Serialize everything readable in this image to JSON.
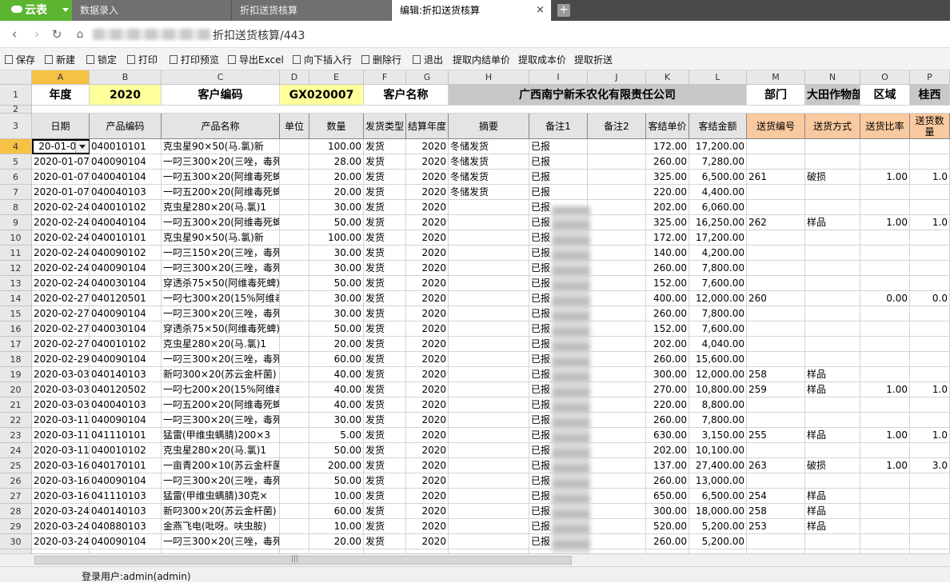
{
  "app": {
    "logo": "云表"
  },
  "tabs": [
    {
      "label": "数据录入"
    },
    {
      "label": "折扣送货核算"
    },
    {
      "label": "编辑:折扣送货核算",
      "active": true,
      "close": "×"
    }
  ],
  "newtab_symbol": "+",
  "address": {
    "path": "折扣送货核算/443"
  },
  "toolbar": [
    {
      "label": "保存",
      "icon": "save-icon"
    },
    {
      "label": "新建",
      "icon": "new-icon"
    },
    {
      "label": "锁定",
      "icon": "lock-icon"
    },
    {
      "label": "打印",
      "icon": "print-icon"
    },
    {
      "label": "打印预览",
      "icon": "print-preview-icon"
    },
    {
      "label": "导出Excel",
      "icon": "excel-icon"
    },
    {
      "label": "向下插入行",
      "icon": "insert-row-icon"
    },
    {
      "label": "删除行",
      "icon": "delete-row-icon"
    },
    {
      "label": "退出",
      "icon": "exit-icon"
    },
    {
      "label": "提取内结单价",
      "icon": ""
    },
    {
      "label": "提取成本价",
      "icon": ""
    },
    {
      "label": "提取折送",
      "icon": ""
    }
  ],
  "sheet": {
    "col_letters": [
      "A",
      "B",
      "C",
      "D",
      "E",
      "F",
      "G",
      "H",
      "I",
      "J",
      "K",
      "L",
      "M",
      "N",
      "O",
      "P"
    ],
    "header_row1": {
      "year_label": "年度",
      "year": "2020",
      "cust_code_label": "客户编码",
      "cust_code": "GX020007",
      "cust_name_label": "客户名称",
      "cust_name": "广西南宁新禾农化有限责任公司",
      "dept_label": "部门",
      "dept": "大田作物部",
      "region_label": "区域",
      "region": "桂西"
    },
    "columns": [
      "日期",
      "产品编码",
      "产品名称",
      "单位",
      "数量",
      "发货类型",
      "结算年度",
      "摘要",
      "备注1",
      "备注2",
      "客结单价",
      "客结金额",
      "送货编号",
      "送货方式",
      "送货比率",
      "送货数量"
    ],
    "first_row_number": 4,
    "rows": [
      [
        "2020-01-07",
        "040010101",
        "克虫星90×50(马.氯)新",
        "",
        "100.00",
        "发货",
        "2020",
        "冬储发货",
        "已报",
        "",
        "172.00",
        "17,200.00",
        "",
        "",
        "",
        ""
      ],
      [
        "2020-01-07",
        "040090104",
        "一叼三300×20(三唑，毒死",
        "",
        "28.00",
        "发货",
        "2020",
        "冬储发货",
        "已报",
        "",
        "260.00",
        "7,280.00",
        "",
        "",
        "",
        ""
      ],
      [
        "2020-01-07",
        "040040104",
        "一叼五300×20(阿维毒死蜱",
        "",
        "20.00",
        "发货",
        "2020",
        "冬储发货",
        "已报",
        "",
        "325.00",
        "6,500.00",
        "261",
        "破损",
        "1.00",
        "1.0"
      ],
      [
        "2020-01-07",
        "040040103",
        "一叼五200×20(阿维毒死蜱",
        "",
        "20.00",
        "发货",
        "2020",
        "冬储发货",
        "已报",
        "",
        "220.00",
        "4,400.00",
        "",
        "",
        "",
        ""
      ],
      [
        "2020-02-24",
        "040010102",
        "克虫星280×20(马.氯)1",
        "",
        "30.00",
        "发货",
        "2020",
        "",
        "已报",
        "",
        "202.00",
        "6,060.00",
        "",
        "",
        "",
        ""
      ],
      [
        "2020-02-24",
        "040040104",
        "一叼五300×20(阿维毒死蜱",
        "",
        "50.00",
        "发货",
        "2020",
        "",
        "已报",
        "",
        "325.00",
        "16,250.00",
        "262",
        "样品",
        "1.00",
        "1.0"
      ],
      [
        "2020-02-24",
        "040010101",
        "克虫星90×50(马.氯)新",
        "",
        "100.00",
        "发货",
        "2020",
        "",
        "已报",
        "",
        "172.00",
        "17,200.00",
        "",
        "",
        "",
        ""
      ],
      [
        "2020-02-24",
        "040090102",
        "一叼三150×20(三唑，毒死",
        "",
        "30.00",
        "发货",
        "2020",
        "",
        "已报",
        "",
        "140.00",
        "4,200.00",
        "",
        "",
        "",
        ""
      ],
      [
        "2020-02-24",
        "040090104",
        "一叼三300×20(三唑，毒死",
        "",
        "30.00",
        "发货",
        "2020",
        "",
        "已报",
        "",
        "260.00",
        "7,800.00",
        "",
        "",
        "",
        ""
      ],
      [
        "2020-02-24",
        "040030104",
        "穿透杀75×50(阿维毒死蜱)",
        "",
        "50.00",
        "发货",
        "2020",
        "",
        "已报",
        "",
        "152.00",
        "7,600.00",
        "",
        "",
        "",
        ""
      ],
      [
        "2020-02-27",
        "040120501",
        "一叼七300×20(15%阿维毒死",
        "",
        "30.00",
        "发货",
        "2020",
        "",
        "已报",
        "",
        "400.00",
        "12,000.00",
        "260",
        "",
        "0.00",
        "0.0"
      ],
      [
        "2020-02-27",
        "040090104",
        "一叼三300×20(三唑，毒死",
        "",
        "30.00",
        "发货",
        "2020",
        "",
        "已报",
        "",
        "260.00",
        "7,800.00",
        "",
        "",
        "",
        ""
      ],
      [
        "2020-02-27",
        "040030104",
        "穿透杀75×50(阿维毒死蜱)",
        "",
        "50.00",
        "发货",
        "2020",
        "",
        "已报",
        "",
        "152.00",
        "7,600.00",
        "",
        "",
        "",
        ""
      ],
      [
        "2020-02-27",
        "040010102",
        "克虫星280×20(马.氯)1",
        "",
        "20.00",
        "发货",
        "2020",
        "",
        "已报",
        "",
        "202.00",
        "4,040.00",
        "",
        "",
        "",
        ""
      ],
      [
        "2020-02-29",
        "040090104",
        "一叼三300×20(三唑，毒死",
        "",
        "60.00",
        "发货",
        "2020",
        "",
        "已报",
        "",
        "260.00",
        "15,600.00",
        "",
        "",
        "",
        ""
      ],
      [
        "2020-03-03",
        "040140103",
        "新叼300×20(苏云金杆菌)",
        "",
        "40.00",
        "发货",
        "2020",
        "",
        "已报",
        "",
        "300.00",
        "12,000.00",
        "258",
        "样品",
        "",
        ""
      ],
      [
        "2020-03-03",
        "040120502",
        "一叼七200×20(15%阿维毒死",
        "",
        "40.00",
        "发货",
        "2020",
        "",
        "已报",
        "",
        "270.00",
        "10,800.00",
        "259",
        "样品",
        "1.00",
        "1.0"
      ],
      [
        "2020-03-03",
        "040040103",
        "一叼五200×20(阿维毒死蜱",
        "",
        "40.00",
        "发货",
        "2020",
        "",
        "已报",
        "",
        "220.00",
        "8,800.00",
        "",
        "",
        "",
        ""
      ],
      [
        "2020-03-11",
        "040090104",
        "一叼三300×20(三唑，毒死",
        "",
        "30.00",
        "发货",
        "2020",
        "",
        "已报",
        "",
        "260.00",
        "7,800.00",
        "",
        "",
        "",
        ""
      ],
      [
        "2020-03-11",
        "041110101",
        "猛雷(甲维虫螨腈)200×3",
        "",
        "5.00",
        "发货",
        "2020",
        "",
        "已报",
        "",
        "630.00",
        "3,150.00",
        "255",
        "样品",
        "1.00",
        "1.0"
      ],
      [
        "2020-03-11",
        "040010102",
        "克虫星280×20(马.氯)1",
        "",
        "50.00",
        "发货",
        "2020",
        "",
        "已报",
        "",
        "202.00",
        "10,100.00",
        "",
        "",
        "",
        ""
      ],
      [
        "2020-03-16",
        "040170101",
        "一亩青200×10(苏云金杆菌",
        "",
        "200.00",
        "发货",
        "2020",
        "",
        "已报",
        "",
        "137.00",
        "27,400.00",
        "263",
        "破损",
        "1.00",
        "3.0"
      ],
      [
        "2020-03-16",
        "040090104",
        "一叼三300×20(三唑，毒死",
        "",
        "50.00",
        "发货",
        "2020",
        "",
        "已报",
        "",
        "260.00",
        "13,000.00",
        "",
        "",
        "",
        ""
      ],
      [
        "2020-03-16",
        "041110103",
        "猛雷(甲维虫螨腈)30克×",
        "",
        "10.00",
        "发货",
        "2020",
        "",
        "已报",
        "",
        "650.00",
        "6,500.00",
        "254",
        "样品",
        "",
        ""
      ],
      [
        "2020-03-24",
        "040140103",
        "新叼300×20(苏云金杆菌)",
        "",
        "60.00",
        "发货",
        "2020",
        "",
        "已报",
        "",
        "300.00",
        "18,000.00",
        "258",
        "样品",
        "",
        ""
      ],
      [
        "2020-03-24",
        "040880103",
        "金燕飞电(吡呀。呋虫胺)",
        "",
        "10.00",
        "发货",
        "2020",
        "",
        "已报",
        "",
        "520.00",
        "5,200.00",
        "253",
        "样品",
        "",
        ""
      ],
      [
        "2020-03-24",
        "040090104",
        "一叼三300×20(三唑，毒死",
        "",
        "20.00",
        "发货",
        "2020",
        "",
        "已报",
        "",
        "260.00",
        "5,200.00",
        "",
        "",
        "",
        ""
      ]
    ],
    "active_cell_value": "20-01-07"
  },
  "status": {
    "user": "登录用户:admin(admin)"
  }
}
